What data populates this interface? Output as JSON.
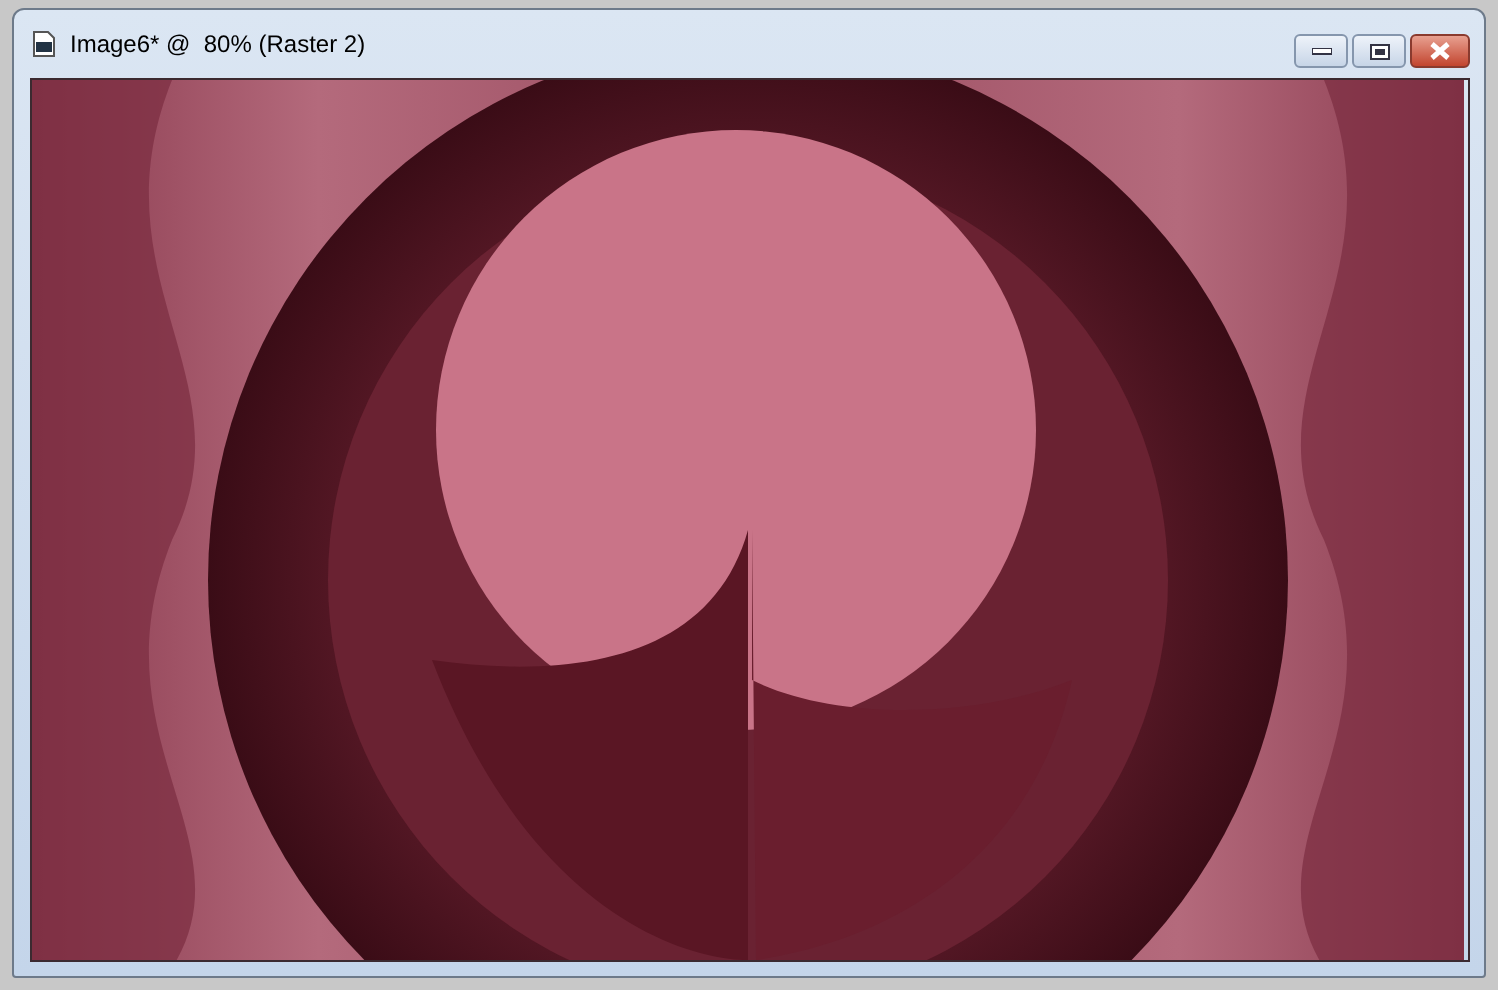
{
  "window": {
    "title": "Image6* @  80% (Raster 2)"
  }
}
